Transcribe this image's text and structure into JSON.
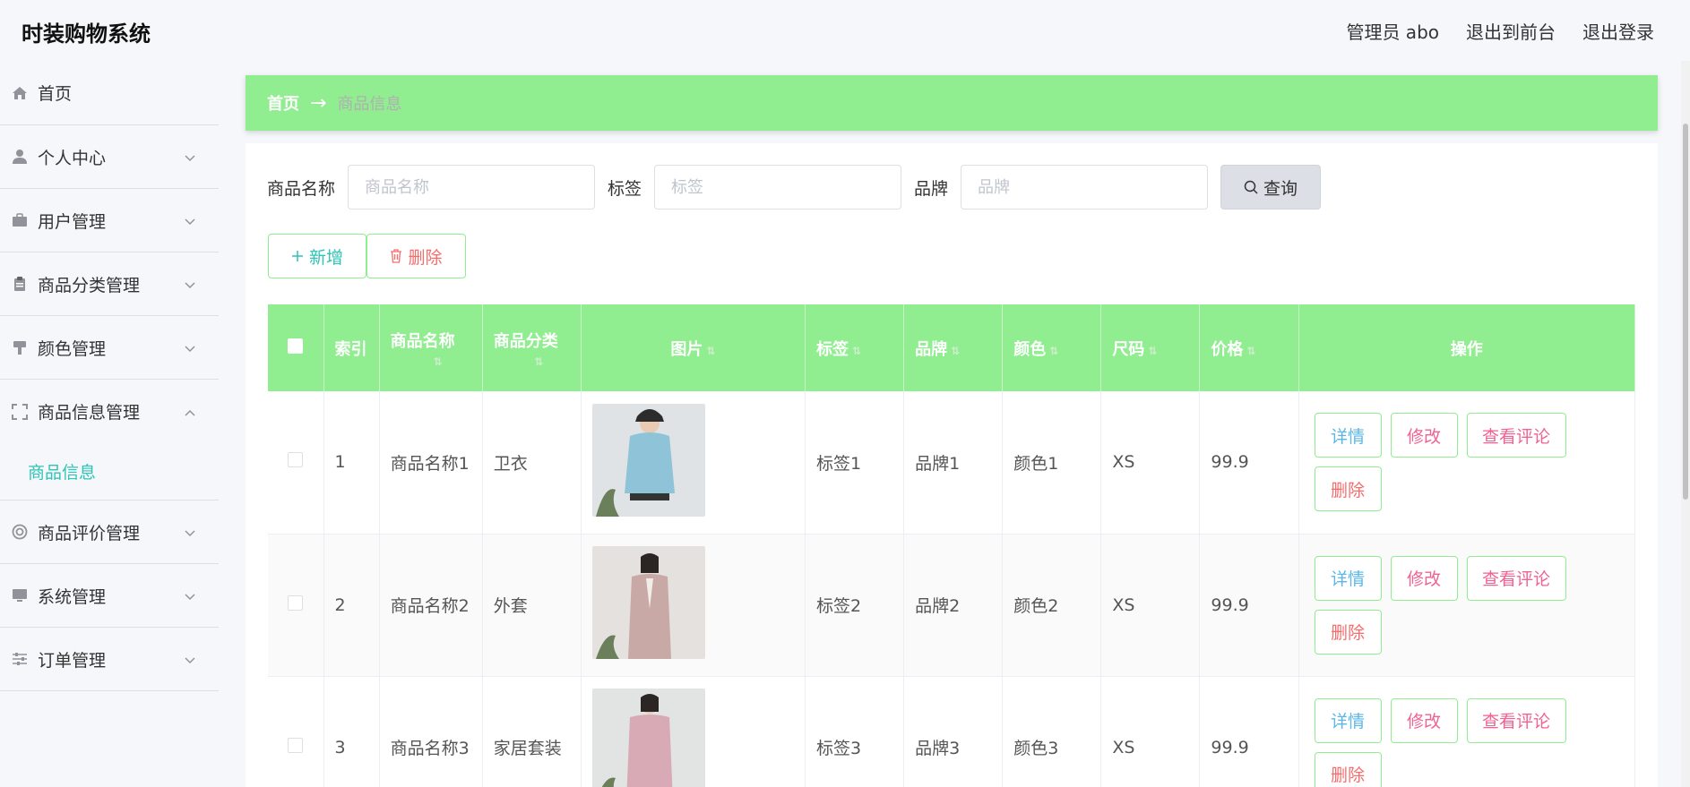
{
  "header": {
    "title": "时装购物系统",
    "links": [
      "管理员 abo",
      "退出到前台",
      "退出登录"
    ]
  },
  "sidebar": {
    "items": [
      {
        "label": "首页",
        "icon": "home-icon",
        "has_arrow": false
      },
      {
        "label": "个人中心",
        "icon": "user-icon",
        "has_arrow": true
      },
      {
        "label": "用户管理",
        "icon": "briefcase-icon",
        "has_arrow": true
      },
      {
        "label": "商品分类管理",
        "icon": "clipboard-icon",
        "has_arrow": true
      },
      {
        "label": "颜色管理",
        "icon": "paint-brush-icon",
        "has_arrow": true
      },
      {
        "label": "商品信息管理",
        "icon": "fullscreen-icon",
        "has_arrow": true,
        "open": true
      },
      {
        "label": "商品评价管理",
        "icon": "lifebuoy-icon",
        "has_arrow": true
      },
      {
        "label": "系统管理",
        "icon": "monitor-icon",
        "has_arrow": true
      },
      {
        "label": "订单管理",
        "icon": "sliders-icon",
        "has_arrow": true
      }
    ],
    "submenu_label": "商品信息"
  },
  "breadcrumb": {
    "home": "首页",
    "arrow": "→",
    "current": "商品信息"
  },
  "search": {
    "name_label": "商品名称",
    "name_placeholder": "商品名称",
    "tag_label": "标签",
    "tag_placeholder": "标签",
    "brand_label": "品牌",
    "brand_placeholder": "品牌",
    "query_label": "查询"
  },
  "actions": {
    "add_label": "新增",
    "delete_label": "删除"
  },
  "table": {
    "columns": [
      "索引",
      "商品名称",
      "商品分类",
      "图片",
      "标签",
      "品牌",
      "颜色",
      "尺码",
      "价格",
      "操作"
    ],
    "rows": [
      {
        "index": "1",
        "name": "商品名称1",
        "category": "卫衣",
        "tag": "标签1",
        "brand": "品牌1",
        "color": "颜色1",
        "size": "XS",
        "price": "99.9",
        "image_color": "#8fc3d8"
      },
      {
        "index": "2",
        "name": "商品名称2",
        "category": "外套",
        "tag": "标签2",
        "brand": "品牌2",
        "color": "颜色2",
        "size": "XS",
        "price": "99.9",
        "image_color": "#c9a9a6"
      },
      {
        "index": "3",
        "name": "商品名称3",
        "category": "家居套装",
        "tag": "标签3",
        "brand": "品牌3",
        "color": "颜色3",
        "size": "XS",
        "price": "99.9",
        "image_color": "#d8aab6"
      }
    ],
    "ops": {
      "detail": "详情",
      "edit": "修改",
      "review": "查看评论",
      "remove": "删除"
    }
  },
  "colors": {
    "accent": "#90ee90",
    "teal": "#2ec4b6",
    "danger": "#f56c6c",
    "pink": "#f06292"
  }
}
